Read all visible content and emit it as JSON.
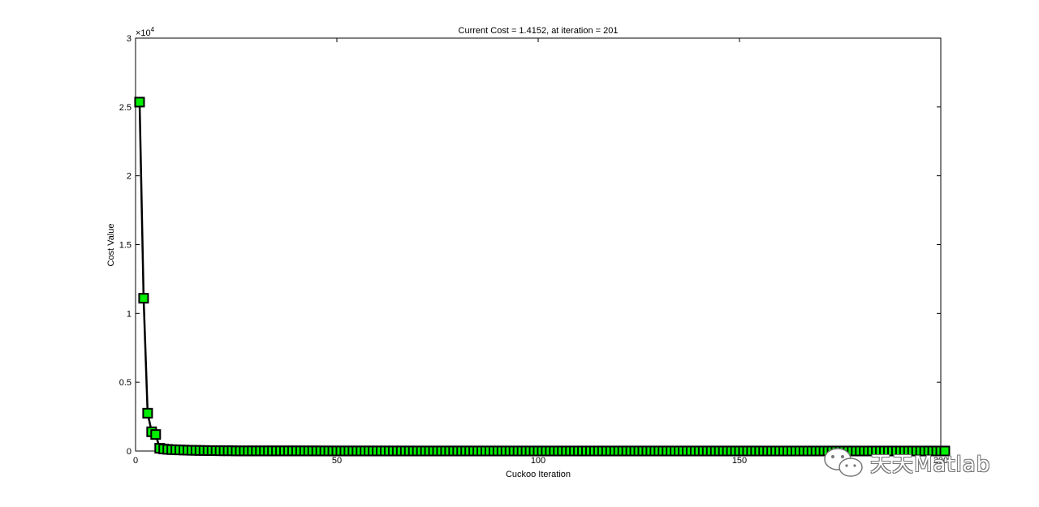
{
  "chart_data": {
    "type": "line",
    "title": "Current Cost = 1.4152, at iteration = 201",
    "xlabel": "Cuckoo Iteration",
    "ylabel": "Cost Value",
    "y_exponent_label": "×10",
    "y_exponent_power": "4",
    "xlim": [
      0,
      200
    ],
    "ylim": [
      0,
      3
    ],
    "x_ticks": [
      "0",
      "50",
      "100",
      "150",
      "200"
    ],
    "y_ticks": [
      "0",
      "0.5",
      "1",
      "1.5",
      "2",
      "2.5",
      "3"
    ],
    "x_tick_values": [
      0,
      50,
      100,
      150,
      200
    ],
    "y_tick_values": [
      0,
      0.5,
      1,
      1.5,
      2,
      2.5,
      3
    ],
    "grid": false,
    "line_color": "#000000",
    "marker": "square",
    "marker_face_color": "#00ee00",
    "marker_edge_color": "#000000",
    "series": [
      {
        "x": [
          1,
          2,
          3,
          4,
          5,
          6,
          7,
          8,
          9,
          10,
          11,
          12,
          13,
          14,
          15,
          16,
          17,
          18,
          19,
          20,
          21,
          22,
          23,
          24,
          25,
          30,
          40,
          50,
          60,
          70,
          80,
          90,
          100,
          110,
          120,
          130,
          140,
          150,
          160,
          170,
          180,
          190,
          201
        ],
        "y": [
          2.535,
          1.11,
          0.275,
          0.14,
          0.12,
          0.02,
          0.015,
          0.012,
          0.01,
          0.009,
          0.008,
          0.007,
          0.006,
          0.005,
          0.005,
          0.004,
          0.004,
          0.003,
          0.003,
          0.003,
          0.002,
          0.002,
          0.002,
          0.002,
          0.001,
          0.001,
          0.001,
          0.0005,
          0.0005,
          0.0003,
          0.0003,
          0.0003,
          0.0002,
          0.0002,
          0.0002,
          0.0002,
          0.0002,
          0.0002,
          0.0001,
          0.0001,
          0.0001,
          0.0001,
          0.00014152
        ]
      }
    ]
  },
  "watermark": {
    "text": "天天Matlab",
    "icon": "wechat-icon"
  }
}
